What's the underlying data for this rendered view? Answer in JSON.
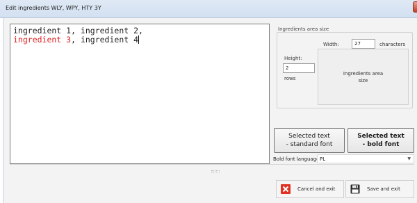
{
  "window": {
    "title": "Edit ingredients WLY, WPY, HTY 3Y"
  },
  "editor": {
    "line1": "ingredient 1, ingredient 2,",
    "line2_red": "ingredient 3",
    "line2_rest": ", ingredient 4"
  },
  "area_size": {
    "group_label": "Ingredients area size",
    "width_label": "Width:",
    "width_value": "27",
    "width_unit": "characters",
    "height_label": "Height:",
    "height_value": "2",
    "height_unit": "rows",
    "preview_label": "Ingredients area size"
  },
  "font_buttons": {
    "standard_line1": "Selected text",
    "standard_line2": "- standard font",
    "bold_line1": "Selected text",
    "bold_line2": "- bold font"
  },
  "language": {
    "label": "Bold font language",
    "value": "PL"
  },
  "actions": {
    "cancel_label": "Cancel and exit",
    "save_label": "Save and exit"
  },
  "colors": {
    "highlight_text": "#e02020",
    "cancel_icon": "#e03020"
  }
}
